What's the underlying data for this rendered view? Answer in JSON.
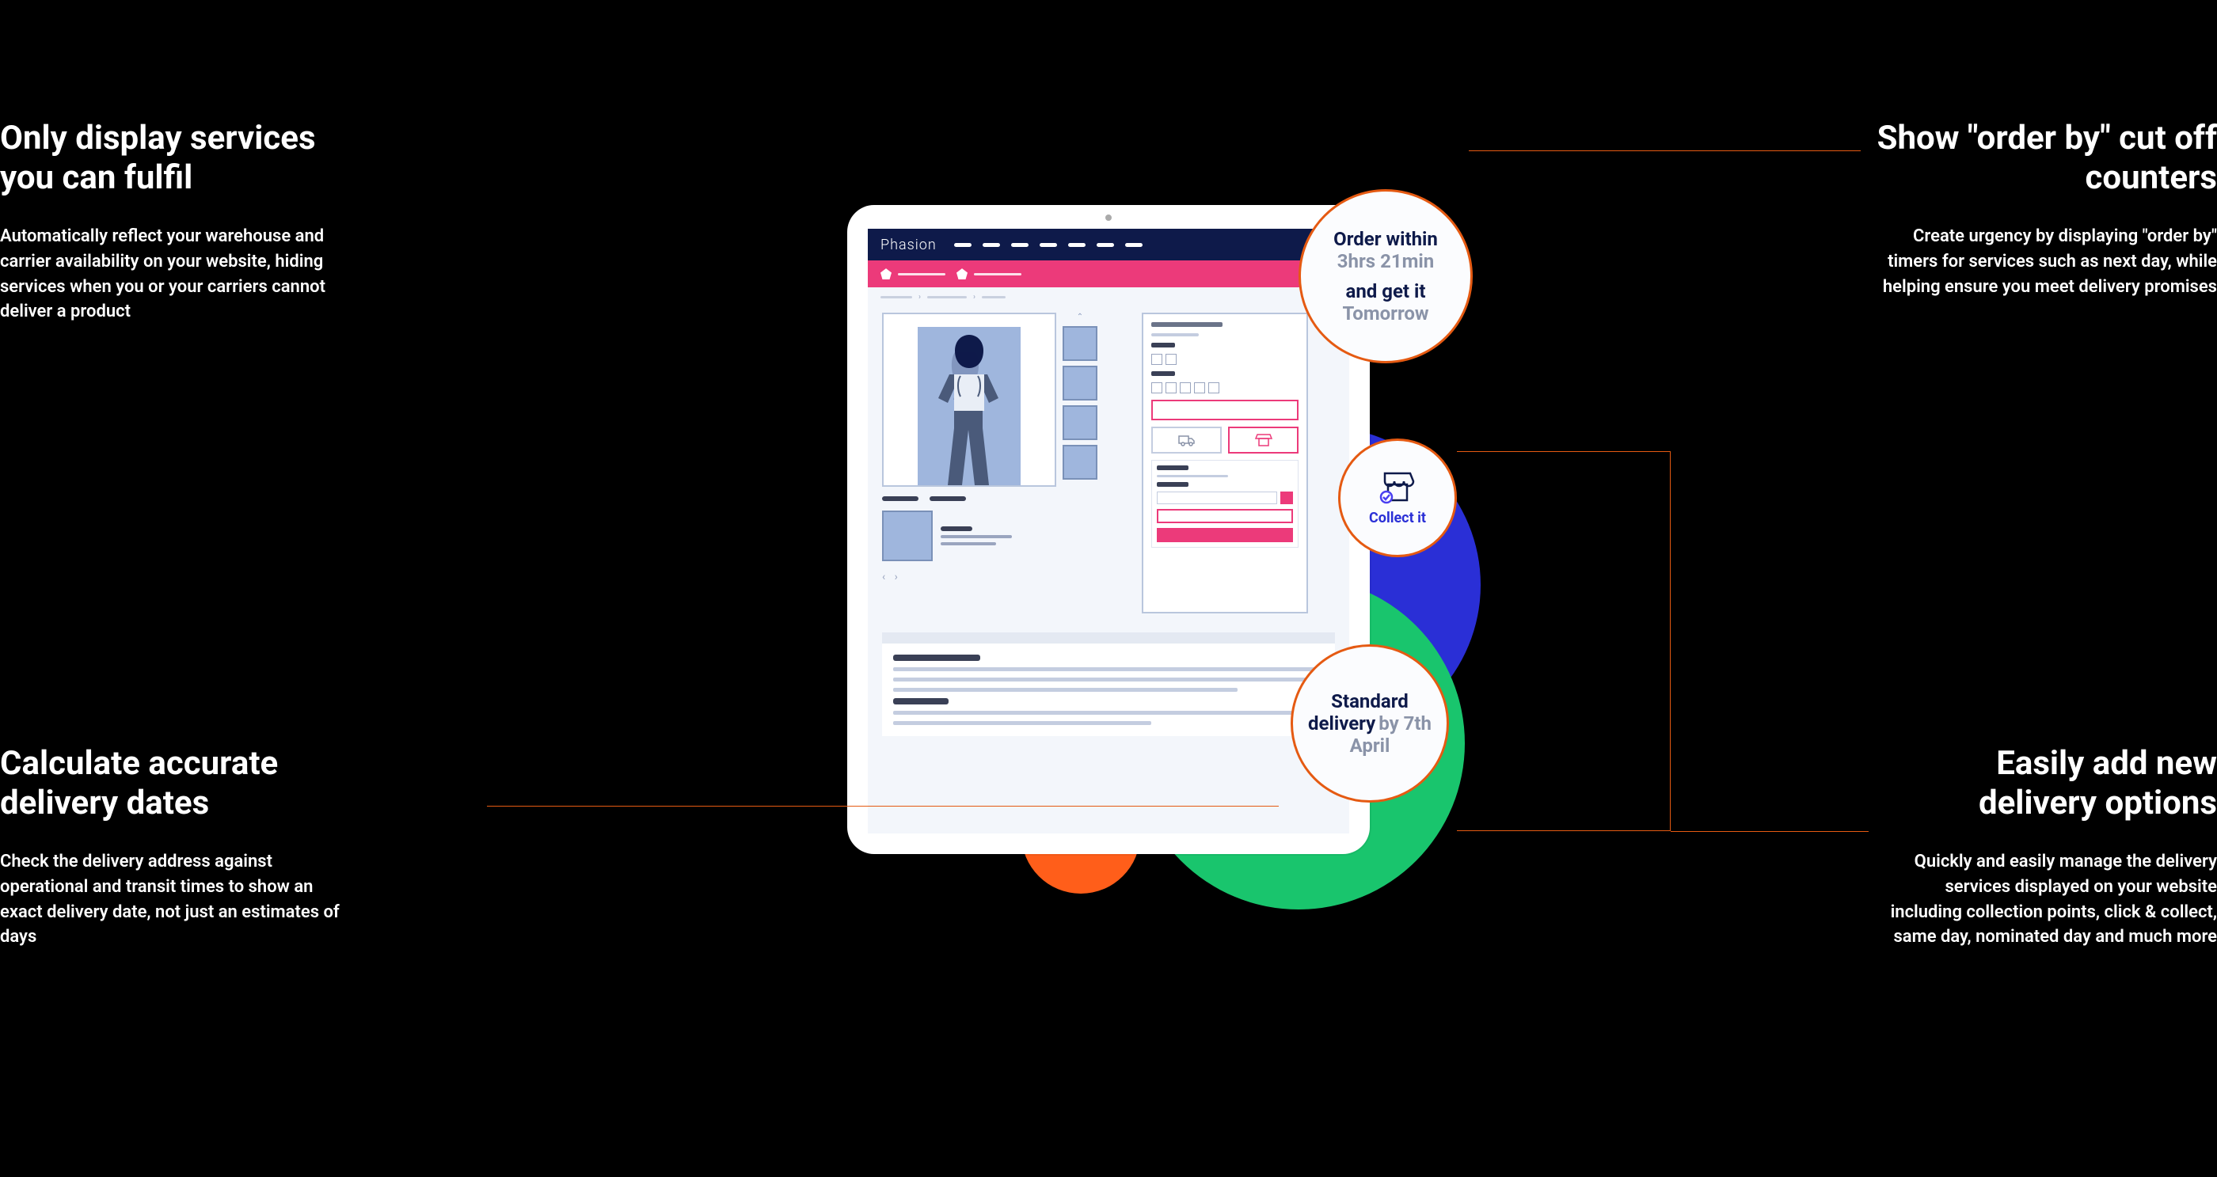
{
  "features": {
    "top_left": {
      "title": "Only display services you can fulfil",
      "desc": "Automatically reflect your warehouse and carrier availability on your website, hiding services when you or your carriers cannot deliver a product"
    },
    "bottom_left": {
      "title": "Calculate accurate delivery dates",
      "desc": "Check the delivery address against operational and transit times to show an exact delivery date, not just an estimates of days"
    },
    "top_right": {
      "title": "Show \"order by\" cut off counters",
      "desc": "Create urgency by displaying \"order by\" timers for services such as next day, while helping ensure you meet delivery promises"
    },
    "bottom_right": {
      "title": "Easily add new delivery options",
      "desc": "Quickly and easily manage the delivery services displayed on your website including collection points, click & collect, same day, nominated day and much more"
    }
  },
  "tablet": {
    "brand": "Phasion"
  },
  "callouts": {
    "order_within": {
      "line1": "Order within",
      "line2": "3hrs 21min",
      "line3": "and get it",
      "line4": "Tomorrow"
    },
    "collect": {
      "label": "Collect it"
    },
    "standard": {
      "line1": "Standard",
      "line2a": "delivery",
      "line2b": "by 7th",
      "line3": "April"
    }
  }
}
